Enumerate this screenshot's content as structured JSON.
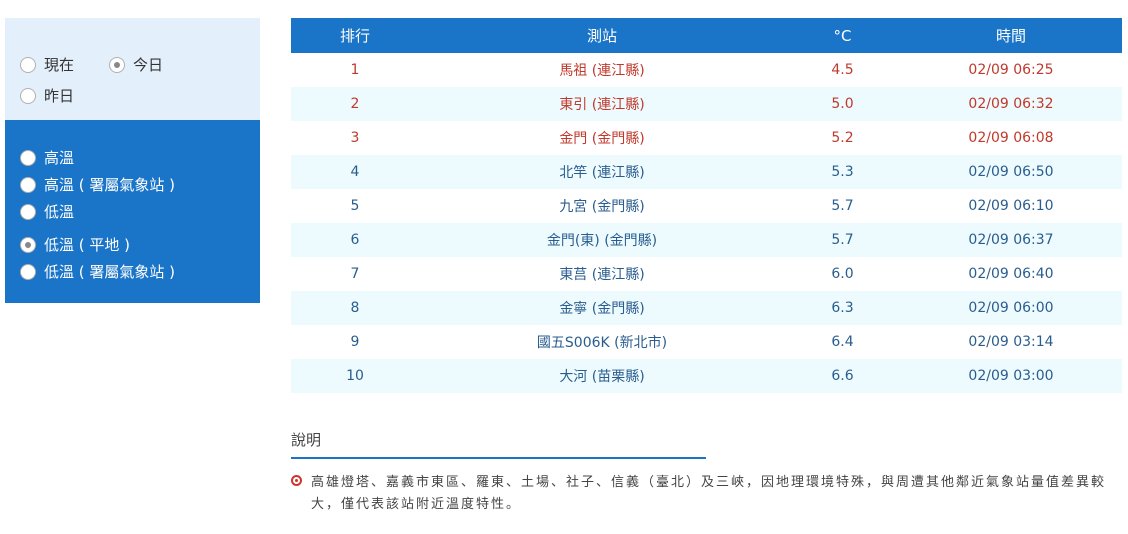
{
  "time_options": [
    {
      "label": "現在",
      "checked": false
    },
    {
      "label": "今日",
      "checked": true
    },
    {
      "label": "昨日",
      "checked": false
    }
  ],
  "type_options": [
    {
      "label": "高溫",
      "checked": false
    },
    {
      "label": "高溫 ( 署屬氣象站 )",
      "checked": false
    },
    {
      "label": "低溫",
      "checked": false
    },
    {
      "label": "低溫 ( 平地 )",
      "checked": true
    },
    {
      "label": "低溫 ( 署屬氣象站 )",
      "checked": false
    }
  ],
  "table": {
    "headers": [
      "排行",
      "測站",
      "°C",
      "時間"
    ],
    "rows": [
      {
        "rank": "1",
        "station": "馬祖 (連江縣)",
        "temp": "4.5",
        "time": "02/09 06:25"
      },
      {
        "rank": "2",
        "station": "東引 (連江縣)",
        "temp": "5.0",
        "time": "02/09 06:32"
      },
      {
        "rank": "3",
        "station": "金門 (金門縣)",
        "temp": "5.2",
        "time": "02/09 06:08"
      },
      {
        "rank": "4",
        "station": "北竿 (連江縣)",
        "temp": "5.3",
        "time": "02/09 06:50"
      },
      {
        "rank": "5",
        "station": "九宮 (金門縣)",
        "temp": "5.7",
        "time": "02/09 06:10"
      },
      {
        "rank": "6",
        "station": "金門(東) (金門縣)",
        "temp": "5.7",
        "time": "02/09 06:37"
      },
      {
        "rank": "7",
        "station": "東莒 (連江縣)",
        "temp": "6.0",
        "time": "02/09 06:40"
      },
      {
        "rank": "8",
        "station": "金寧 (金門縣)",
        "temp": "6.3",
        "time": "02/09 06:00"
      },
      {
        "rank": "9",
        "station": "國五S006K (新北市)",
        "temp": "6.4",
        "time": "02/09 03:14"
      },
      {
        "rank": "10",
        "station": "大河 (苗栗縣)",
        "temp": "6.6",
        "time": "02/09 03:00"
      }
    ]
  },
  "notes": {
    "title": "說明",
    "items": [
      "高雄燈塔、嘉義市東區、羅東、土場、社子、信義（臺北）及三峽，因地理環境特殊，與周遭其他鄰近氣象站量值差異較大，僅代表該站附近溫度特性。"
    ]
  },
  "colors": {
    "accent": "#1a74c7",
    "highlight": "#c0392b",
    "row_alt": "#eefbfe",
    "panel_light": "#e3f0fb"
  }
}
